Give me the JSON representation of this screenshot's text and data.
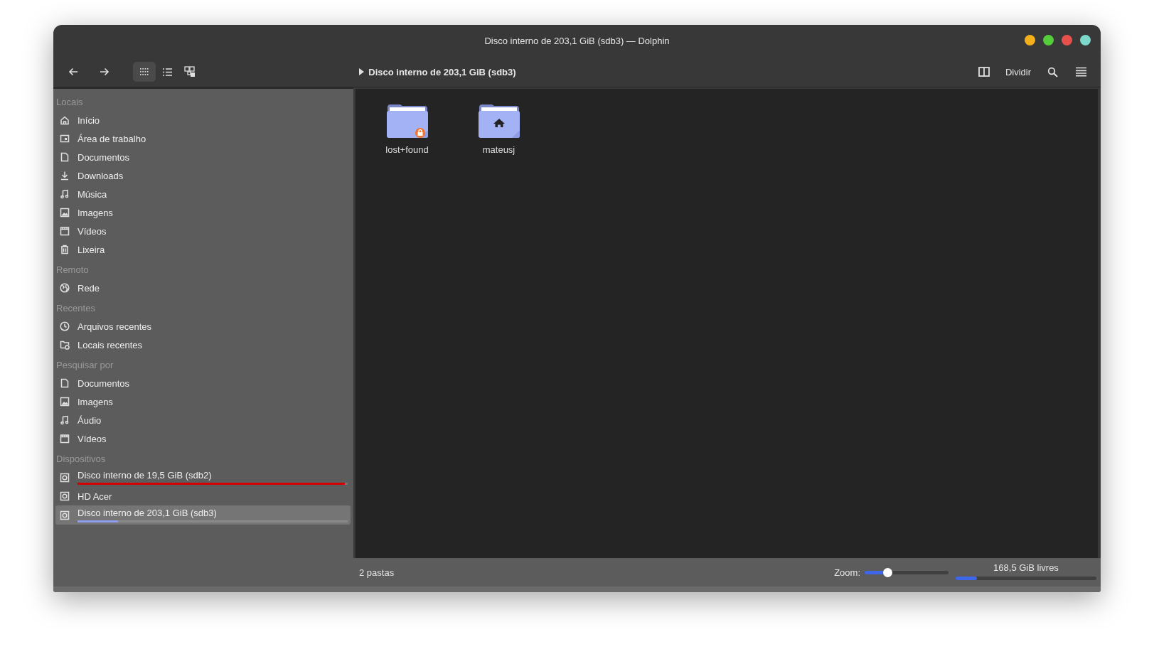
{
  "window": {
    "title": "Disco interno de 203,1 GiB (sdb3) — Dolphin",
    "controls": [
      {
        "color": "#f4b01b"
      },
      {
        "color": "#55cc3a"
      },
      {
        "color": "#e8504c"
      },
      {
        "color": "#7dd8cc"
      }
    ]
  },
  "toolbar": {
    "view_modes": [
      {
        "selected": true
      },
      {
        "selected": false
      },
      {
        "selected": false
      }
    ],
    "breadcrumb": "Disco interno de 203,1 GiB (sdb3)",
    "split_label": "Dividir"
  },
  "sidebar": {
    "sections": [
      {
        "title": "Locais",
        "items": [
          {
            "label": "Início",
            "selected": false
          },
          {
            "label": "Área de trabalho",
            "selected": false
          },
          {
            "label": "Documentos",
            "selected": false
          },
          {
            "label": "Downloads",
            "selected": false
          },
          {
            "label": "Música",
            "selected": false
          },
          {
            "label": "Imagens",
            "selected": false
          },
          {
            "label": "Vídeos",
            "selected": false
          },
          {
            "label": "Lixeira",
            "selected": false
          }
        ]
      },
      {
        "title": "Remoto",
        "items": [
          {
            "label": "Rede",
            "selected": false
          }
        ]
      },
      {
        "title": "Recentes",
        "items": [
          {
            "label": "Arquivos recentes",
            "selected": false
          },
          {
            "label": "Locais recentes",
            "selected": false
          }
        ]
      },
      {
        "title": "Pesquisar por",
        "items": [
          {
            "label": "Documentos",
            "selected": false
          },
          {
            "label": "Imagens",
            "selected": false
          },
          {
            "label": "Áudio",
            "selected": false
          },
          {
            "label": "Vídeos",
            "selected": false
          }
        ]
      },
      {
        "title": "Dispositivos",
        "items": [
          {
            "label": "Disco interno de 19,5 GiB (sdb2)",
            "selected": false,
            "level": 0.99
          },
          {
            "label": "HD Acer",
            "selected": false
          },
          {
            "label": "Disco interno de 203,1 GiB (sdb3)",
            "selected": true,
            "level": 0.15
          }
        ]
      }
    ]
  },
  "view": {
    "items": [
      {
        "name": "lost+found",
        "kind": "locked"
      },
      {
        "name": "mateusj",
        "kind": "home"
      }
    ]
  },
  "status_bar": {
    "summary": "2 pastas",
    "zoom_label": "Zoom:",
    "zoom": {
      "level": 0.28
    },
    "free_space": "168,5 GiB livres",
    "usage": {
      "level": 0.15
    }
  }
}
